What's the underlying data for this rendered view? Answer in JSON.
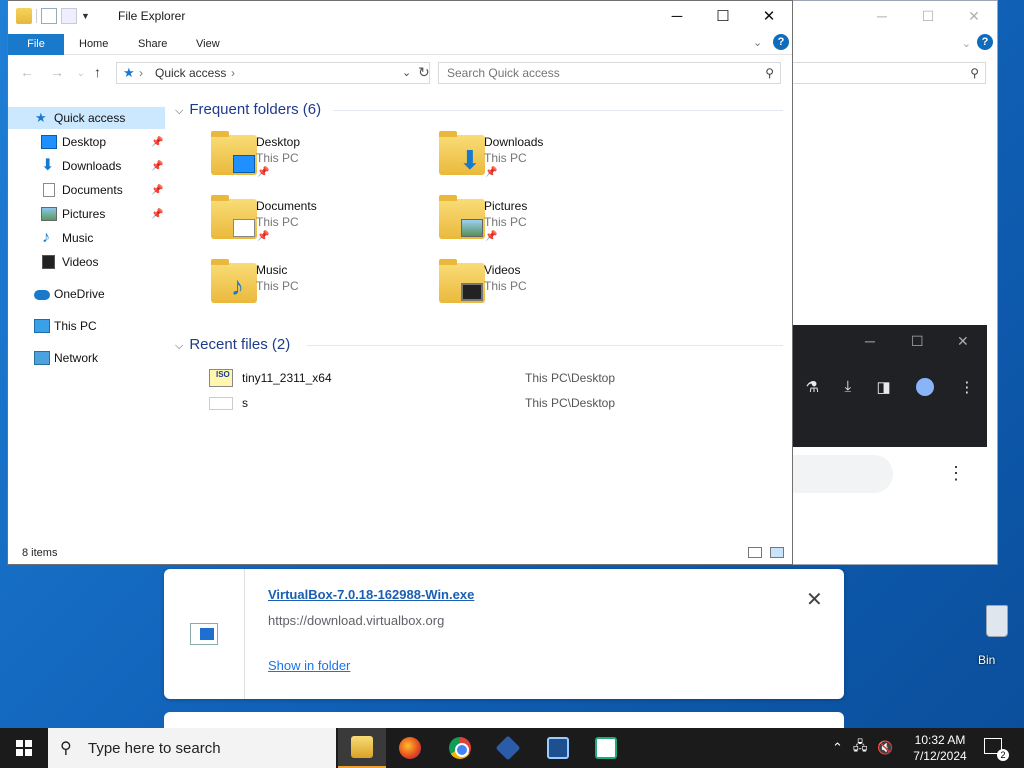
{
  "window": {
    "title": "File Explorer",
    "minimize": "─",
    "maximize": "☐",
    "close": "✕"
  },
  "ribbon": {
    "tabs": [
      "File",
      "Home",
      "Share",
      "View"
    ],
    "help": "?"
  },
  "navigation": {
    "address": "Quick access",
    "search_placeholder": "Search Quick access"
  },
  "sidebar": {
    "items": [
      {
        "label": "Quick access",
        "icon": "quick-access-star-icon",
        "selected": true
      },
      {
        "label": "Desktop",
        "icon": "desktop-icon",
        "pinned": true
      },
      {
        "label": "Downloads",
        "icon": "downloads-icon",
        "pinned": true
      },
      {
        "label": "Documents",
        "icon": "documents-icon",
        "pinned": true
      },
      {
        "label": "Pictures",
        "icon": "pictures-icon",
        "pinned": true
      },
      {
        "label": "Music",
        "icon": "music-icon"
      },
      {
        "label": "Videos",
        "icon": "videos-icon"
      },
      {
        "label": "OneDrive",
        "icon": "onedrive-icon"
      },
      {
        "label": "This PC",
        "icon": "this-pc-icon"
      },
      {
        "label": "Network",
        "icon": "network-icon"
      }
    ]
  },
  "frequent": {
    "header": "Frequent folders (6)",
    "folders": [
      {
        "name": "Desktop",
        "location": "This PC",
        "pinned": true
      },
      {
        "name": "Downloads",
        "location": "This PC",
        "pinned": true
      },
      {
        "name": "Documents",
        "location": "This PC",
        "pinned": true
      },
      {
        "name": "Pictures",
        "location": "This PC",
        "pinned": true
      },
      {
        "name": "Music",
        "location": "This PC"
      },
      {
        "name": "Videos",
        "location": "This PC"
      }
    ]
  },
  "recent": {
    "header": "Recent files (2)",
    "files": [
      {
        "name": "tiny11_2311_x64",
        "path": "This PC\\Desktop",
        "icon": "iso-file-icon",
        "badge": "ISO"
      },
      {
        "name": "s",
        "path": "This PC\\Desktop",
        "icon": "blank-file-icon"
      }
    ]
  },
  "status": {
    "item_count": "8 items"
  },
  "download": {
    "filename": "VirtualBox-7.0.18-162988-Win.exe",
    "url": "https://download.virtualbox.org",
    "show_in_folder": "Show in folder"
  },
  "desktop": {
    "recycle_bin_label": "Bin"
  },
  "taskbar": {
    "search_placeholder": "Type here to search",
    "time": "10:32 AM",
    "date": "7/12/2024",
    "notification_count": "2"
  }
}
